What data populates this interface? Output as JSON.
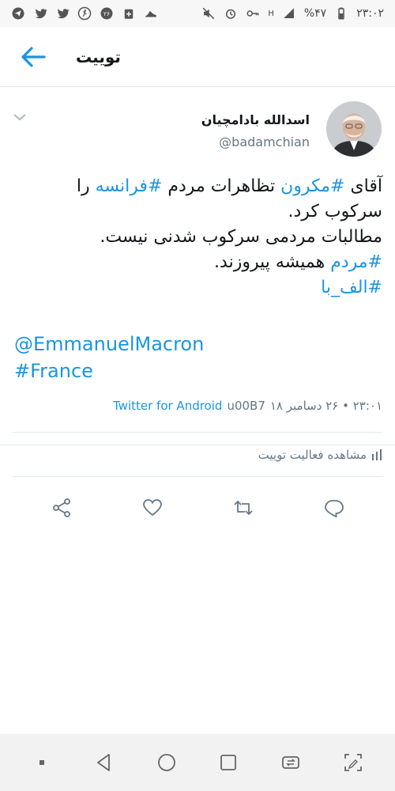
{
  "status_bar": {
    "time": "۲۳:۰۲",
    "battery": "%۴۷",
    "network": "H",
    "icons_left": [
      "telegram-icon",
      "twitter-icon",
      "twitter-icon",
      "runner-icon",
      "badge-icon",
      "medical-icon",
      "shoe-icon"
    ],
    "icons_right": [
      "mute-icon",
      "alarm-icon",
      "key-icon",
      "signal-icon",
      "battery-icon"
    ]
  },
  "header": {
    "title": "توییت",
    "back_icon": "arrow-left-icon"
  },
  "tweet": {
    "display_name": "اسدالله بادامچیان",
    "handle": "@badamchian",
    "body": {
      "line1_prefix": "آقای ",
      "tag_macron": "#مکرون",
      "line1_mid": " تظاهرات مردم ",
      "tag_france_fa": "#فرانسه",
      "line1_suffix": " را",
      "line2": "سرکوب کرد.",
      "line3": "مطالبات مردمی سرکوب شدنی نیست.",
      "tag_mardom": "#مردم",
      "line4_suffix": " همیشه پیروزند.",
      "tag_alefba": "#الف_با",
      "mention": "@EmmanuelMacron",
      "tag_france": "#France"
    },
    "meta": {
      "timestamp": "۲۳:۰۱ • ۲۶ دسامبر ۱۸",
      "separator": "u00B7",
      "source": "Twitter for Android"
    },
    "activity_label": "مشاهده فعالیت توییت"
  },
  "actions": {
    "icons": [
      "share-icon",
      "like-icon",
      "retweet-icon",
      "reply-icon"
    ]
  },
  "colors": {
    "accent": "#1b95e0",
    "text": "#14171a",
    "muted": "#657786",
    "border": "#e1e8ed"
  }
}
